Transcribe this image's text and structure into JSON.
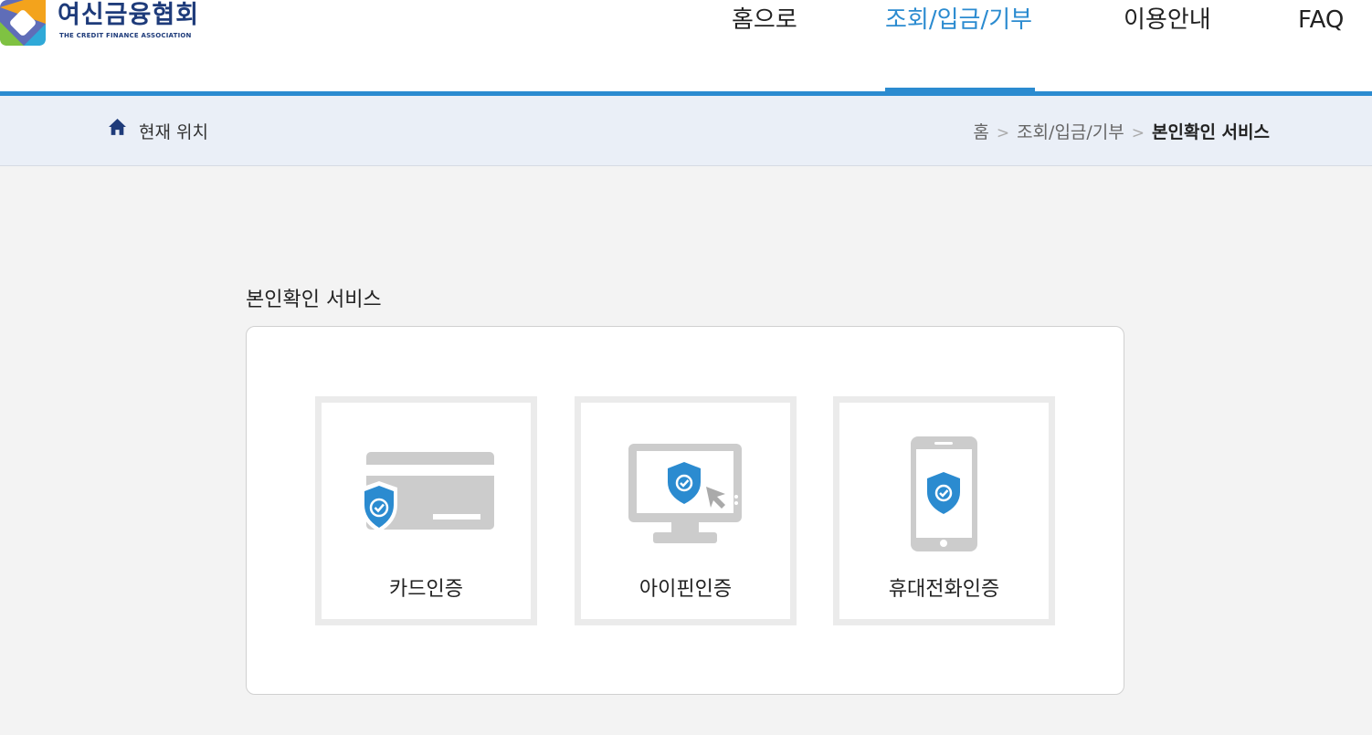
{
  "header": {
    "logo_title": "여신금융협회",
    "logo_subtitle": "THE CREDIT FINANCE ASSOCIATION",
    "nav": [
      {
        "label": "홈으로",
        "active": false
      },
      {
        "label": "조회/입금/기부",
        "active": true
      },
      {
        "label": "이용안내",
        "active": false
      },
      {
        "label": "FAQ",
        "active": false
      }
    ]
  },
  "location": {
    "label": "현재 위치",
    "breadcrumb": [
      "홈",
      "조회/입금/기부",
      "본인확인 서비스"
    ]
  },
  "main": {
    "title": "본인확인 서비스",
    "options": [
      {
        "label": "카드인증",
        "icon": "credit-card-shield-icon"
      },
      {
        "label": "아이핀인증",
        "icon": "monitor-shield-icon"
      },
      {
        "label": "휴대전화인증",
        "icon": "mobile-phone-shield-icon"
      }
    ]
  },
  "colors": {
    "accent": "#2b8bd0",
    "brand_navy": "#1e3b7a",
    "location_bar": "#eaeff7",
    "icon_gray": "#cccccc"
  }
}
